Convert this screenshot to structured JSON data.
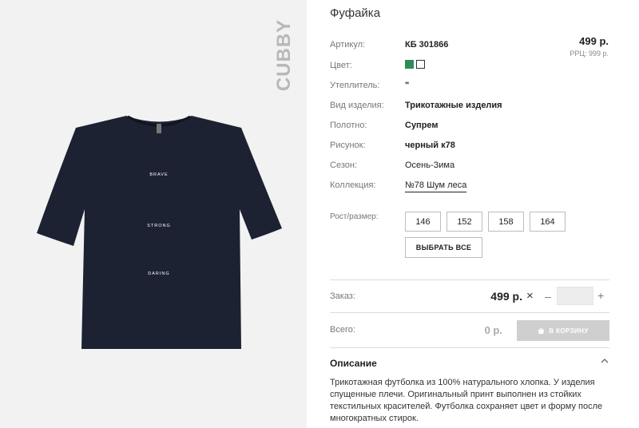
{
  "product": {
    "brand_logo": "CUBBY",
    "title": "Фуфайка",
    "price": "499 р.",
    "rrp": "РРЦ: 999 р.",
    "print_lines": [
      "BRAVE",
      "STRONG",
      "DARING"
    ]
  },
  "specs": {
    "article": {
      "label": "Артикул:",
      "value": "КБ 301866"
    },
    "color": {
      "label": "Цвет:",
      "swatches": [
        "#2e8b57",
        "#ffffff"
      ]
    },
    "insulation": {
      "label": "Утеплитель:",
      "value": "\""
    },
    "kind": {
      "label": "Вид изделия:",
      "value": "Трикотажные изделия"
    },
    "fabric": {
      "label": "Полотно:",
      "value": "Супрем"
    },
    "pattern": {
      "label": "Рисунок:",
      "value": "черный к78"
    },
    "season": {
      "label": "Сезон:",
      "value": "Осень-Зима"
    },
    "collection": {
      "label": "Коллекция:",
      "value": "№78 Шум леса"
    }
  },
  "sizes": {
    "label": "Рост/размер:",
    "options": [
      "146",
      "152",
      "158",
      "164"
    ],
    "select_all": "ВЫБРАТЬ ВСЕ"
  },
  "order": {
    "label": "Заказ:",
    "price": "499 р.",
    "times": "×",
    "minus": "–",
    "plus": "+",
    "quantity": ""
  },
  "total": {
    "label": "Всего:",
    "value": "0 р.",
    "cart_button": "В КОРЗИНУ",
    "cart_icon": "basket-icon"
  },
  "description": {
    "heading": "Описание",
    "chevron": "chevron-up-icon",
    "text": "Трикотажная футболка из 100% натурального хлопка. У изделия спущенные плечи. Оригинальный принт выполнен из стойких текстильных красителей. Футболка сохраняет цвет и форму после многократных стирок."
  }
}
